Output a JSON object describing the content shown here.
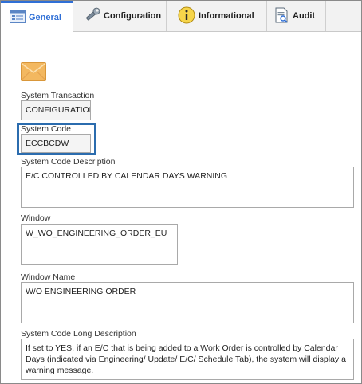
{
  "tabs": [
    {
      "label": "General",
      "icon": "general-form-icon",
      "active": true
    },
    {
      "label": "Configuration",
      "icon": "wrench-icon",
      "active": false
    },
    {
      "label": "Informational",
      "icon": "info-icon",
      "active": false
    },
    {
      "label": "Audit",
      "icon": "audit-document-icon",
      "active": false
    }
  ],
  "header_icon": "envelope-icon",
  "fields": {
    "system_transaction": {
      "label": "System Transaction",
      "value": "CONFIGURATION"
    },
    "system_code": {
      "label": "System Code",
      "value": "ECCBCDW"
    },
    "system_code_description": {
      "label": "System Code Description",
      "value": "E/C CONTROLLED BY CALENDAR DAYS WARNING"
    },
    "window": {
      "label": "Window",
      "value": "W_WO_ENGINEERING_ORDER_EU"
    },
    "window_name": {
      "label": "Window Name",
      "value": "W/O ENGINEERING ORDER"
    },
    "system_code_long_description": {
      "label": "System Code Long Description",
      "value": "If set to YES, if an E/C that is being added to a Work Order is controlled by Calendar Days (indicated via Engineering/ Update/ E/C/ Schedule Tab), the system will display a warning message."
    }
  },
  "colors": {
    "accent": "#2f6fd6",
    "focus_border": "#2b6cae",
    "envelope": "#f3b860"
  }
}
